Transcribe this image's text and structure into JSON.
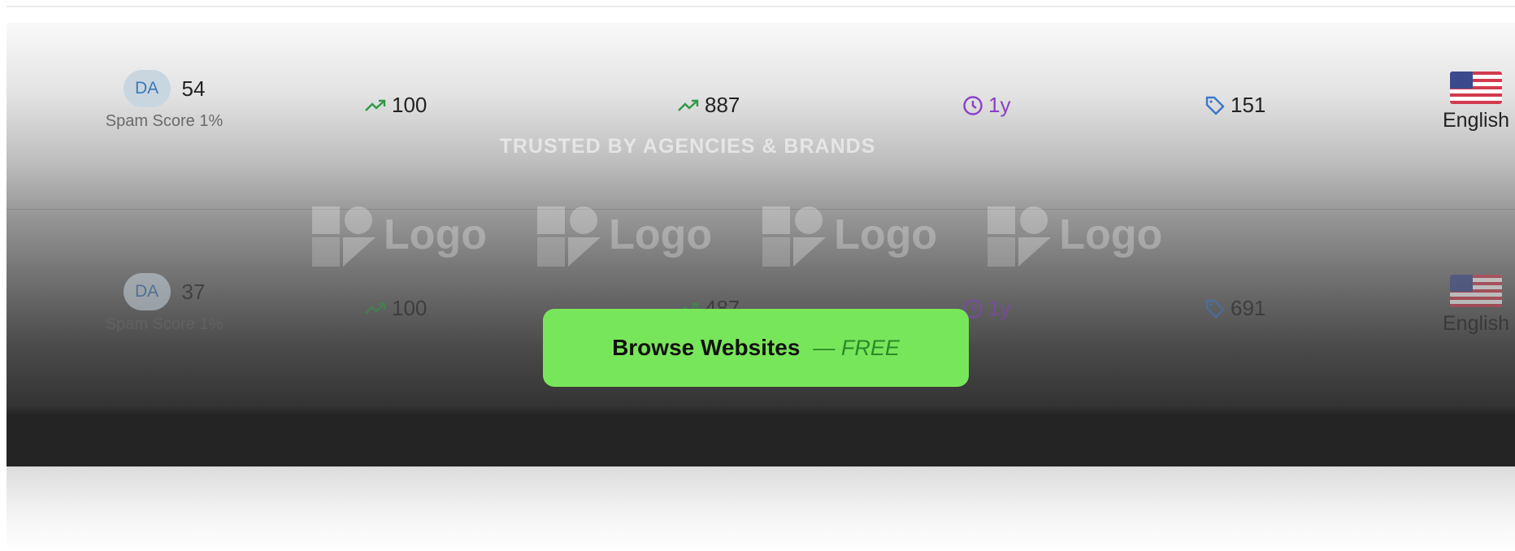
{
  "rows": [
    {
      "da_label": "DA",
      "da_value": "54",
      "spam_score": "Spam Score 1%",
      "traffic": "100",
      "referring": "887",
      "age": "1y",
      "price": "151",
      "language": "English"
    },
    {
      "da_label": "DA",
      "da_value": "37",
      "spam_score": "Spam Score 1%",
      "traffic": "100",
      "referring": "487",
      "age": "1y",
      "price": "691",
      "language": "English"
    }
  ],
  "overlay": {
    "title": "TRUSTED BY AGENCIES & BRANDS",
    "logos": [
      "Logo",
      "Logo",
      "Logo",
      "Logo"
    ],
    "cta_label": "Browse Websites",
    "cta_suffix": "— FREE"
  },
  "icons": {
    "traffic": "trend-up-icon",
    "referring": "trend-up-icon",
    "age": "clock-icon",
    "price": "tag-icon",
    "language": "us-flag-icon"
  },
  "colors": {
    "trend": "#2f9a45",
    "age": "#8a3fc8",
    "tag": "#3a78c8",
    "cta": "#78e65a",
    "da_badge": "#c9d6e0"
  }
}
